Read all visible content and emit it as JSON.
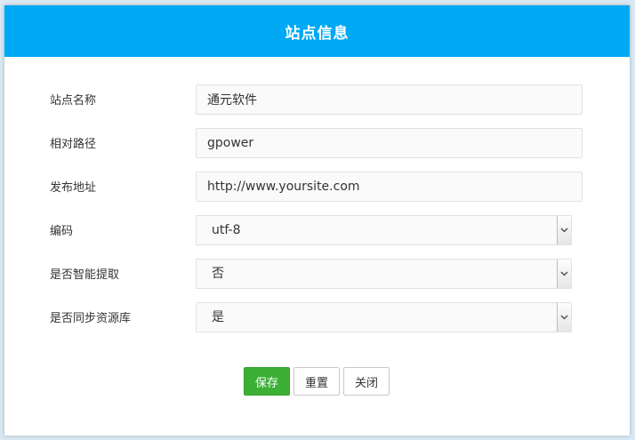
{
  "dialog": {
    "title": "站点信息"
  },
  "form": {
    "site_name": {
      "label": "站点名称",
      "value": "通元软件"
    },
    "relative_path": {
      "label": "相对路径",
      "value": "gpower"
    },
    "publish_url": {
      "label": "发布地址",
      "value": "http://www.yoursite.com"
    },
    "encoding": {
      "label": "编码",
      "value": "utf-8"
    },
    "smart_extract": {
      "label": "是否智能提取",
      "value": "否"
    },
    "sync_resource": {
      "label": "是否同步资源库",
      "value": "是"
    }
  },
  "buttons": {
    "save": "保存",
    "reset": "重置",
    "close": "关闭"
  },
  "colors": {
    "header": "#00a9f4",
    "primary_button": "#3cb034"
  }
}
